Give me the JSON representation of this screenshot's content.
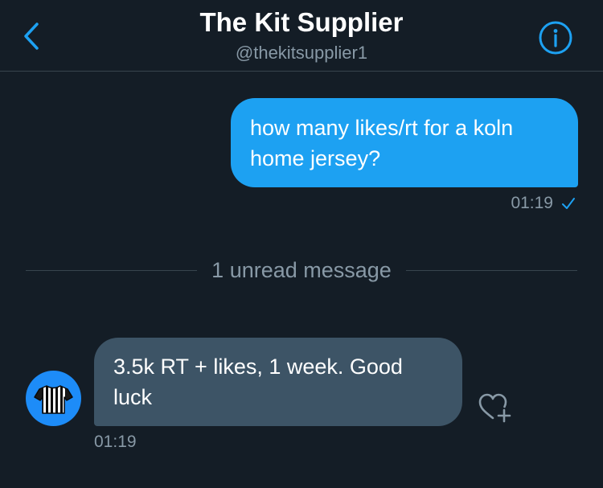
{
  "header": {
    "title": "The Kit Supplier",
    "handle": "@thekitsupplier1",
    "back_icon": "chevron-left-icon",
    "info_icon": "info-icon"
  },
  "conversation": {
    "outgoing": {
      "text": "how many likes/rt for a koln home jersey?",
      "time": "01:19",
      "status_icon": "check-icon"
    },
    "divider": {
      "text": "1 unread message"
    },
    "incoming": {
      "text": "3.5k RT + likes, 1 week. Good luck",
      "time": "01:19",
      "avatar_icon": "striped-jersey-icon",
      "reaction_icon": "heart-plus-icon"
    }
  },
  "colors": {
    "background": "#141d26",
    "accent": "#1da1f2",
    "incoming_bubble": "#3d5466",
    "muted_text": "#8899a6",
    "divider": "#38444d"
  }
}
